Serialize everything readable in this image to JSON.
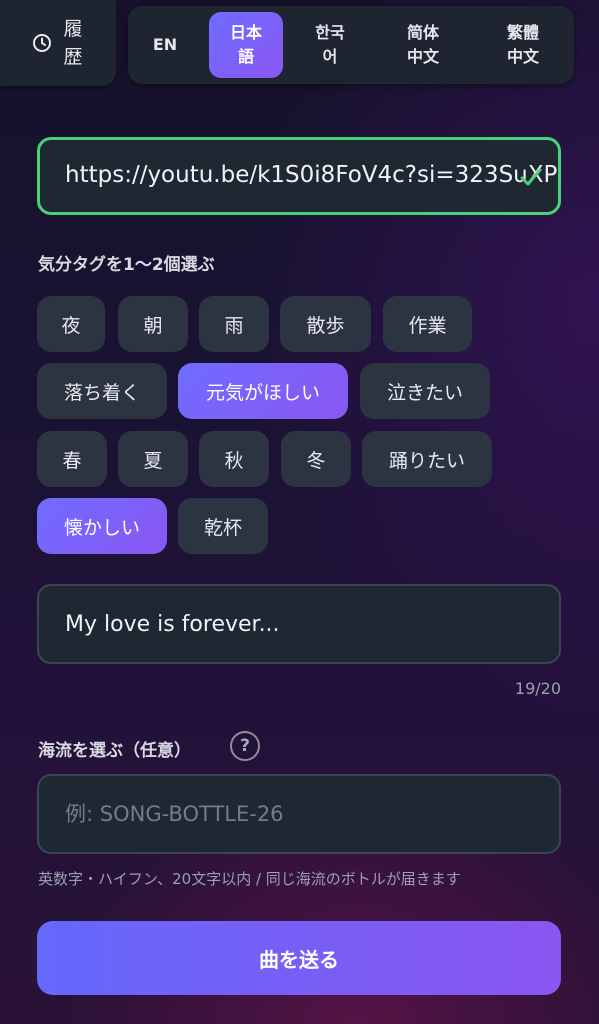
{
  "history": {
    "label": "履歴",
    "icon": "clock-icon"
  },
  "languages": [
    {
      "label": "EN",
      "active": false
    },
    {
      "label": "日本語",
      "active": true
    },
    {
      "label": "한국어",
      "active": false
    },
    {
      "label": "简体中文",
      "active": false
    },
    {
      "label": "繁體中文",
      "active": false
    }
  ],
  "url_input": {
    "value": "https://youtu.be/k1S0i8FoV4c?si=323SuXP",
    "valid_icon": "check-icon",
    "accent": "#49d17a"
  },
  "mood_section": {
    "label": "気分タグを1〜2個選ぶ",
    "tags": [
      {
        "label": "夜",
        "selected": false
      },
      {
        "label": "朝",
        "selected": false
      },
      {
        "label": "雨",
        "selected": false
      },
      {
        "label": "散歩",
        "selected": false
      },
      {
        "label": "作業",
        "selected": false
      },
      {
        "label": "落ち着く",
        "selected": false
      },
      {
        "label": "元気がほしい",
        "selected": true
      },
      {
        "label": "泣きたい",
        "selected": false
      },
      {
        "label": "春",
        "selected": false
      },
      {
        "label": "夏",
        "selected": false
      },
      {
        "label": "秋",
        "selected": false
      },
      {
        "label": "冬",
        "selected": false
      },
      {
        "label": "踊りたい",
        "selected": false
      },
      {
        "label": "懐かしい",
        "selected": true
      },
      {
        "label": "乾杯",
        "selected": false
      }
    ]
  },
  "message": {
    "value": "My love is forever...",
    "counter": "19/20"
  },
  "current_section": {
    "label": "海流を選ぶ（任意）",
    "help_icon": "help-icon",
    "help_glyph": "?",
    "placeholder": "例: SONG-BOTTLE-26",
    "hint": "英数字・ハイフン、20文字以内 / 同じ海流のボトルが届きます"
  },
  "send_button": {
    "label": "曲を送る"
  },
  "colors": {
    "accent_start": "#6f6cff",
    "accent_end": "#8a57f2",
    "surface": "#1f2733"
  }
}
